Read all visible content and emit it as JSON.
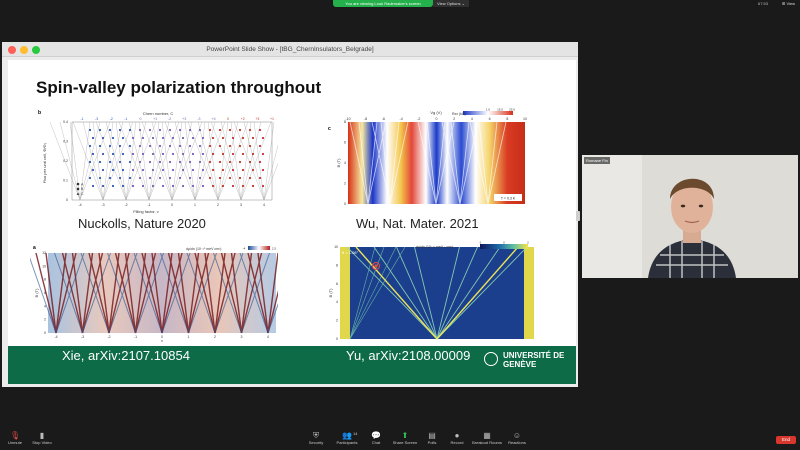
{
  "banner": {
    "share_text": "You are viewing Louk Rademaker's screen",
    "view_options": "View Options ⌄"
  },
  "top_right": {
    "status": "67:53",
    "view": "⊞ View"
  },
  "window": {
    "title": "PowerPoint Slide Show - [tBG_ChernInsulators_Belgrade]"
  },
  "slide": {
    "title": "Spin-valley polarization throughout",
    "captions": {
      "tl": "Nuckolls, Nature 2020",
      "tr": "Wu, Nat. Mater. 2021",
      "bl": "Xie, arXiv:2107.10854",
      "br": "Yu, arXiv:2108.00009"
    },
    "university": "UNIVERSITÉ DE GENÈVE"
  },
  "figures": {
    "tl": {
      "panel": "b",
      "top_label": "Chern number, C",
      "ylabel": "Flux per unit cell, Φ/Φ₀",
      "xlabel": "Filling factor, ν",
      "chern": [
        "-1",
        "-3",
        "-2",
        "-1",
        "0",
        "+1",
        "-2",
        "+3",
        "-3",
        "+4",
        "0",
        "+2",
        "+3",
        "+1"
      ],
      "xticks": [
        "-4",
        "-3",
        "-2",
        "-1",
        "0",
        "1",
        "2",
        "3",
        "4"
      ],
      "yticks": [
        "0",
        "0.1",
        "0.2",
        "0.3",
        "0.4"
      ],
      "legend": [
        "A",
        "B",
        "C"
      ]
    },
    "tr": {
      "panel": "c",
      "xlabel": "Vg (V)",
      "ylabel": "B (T)",
      "xticks": [
        "-10",
        "-8",
        "-6",
        "-4",
        "-2",
        "0",
        "2",
        "4",
        "6",
        "8",
        "10"
      ],
      "yticks": [
        "0",
        "2",
        "4",
        "6",
        "8"
      ],
      "cbar_label": "Rxx (kΩ)",
      "cbar_ticks": [
        "1.0",
        "15.0",
        "25.0"
      ],
      "temp": "T = 0.3 K"
    },
    "bl": {
      "panel": "a",
      "cbar_label": "dμ/dn (10⁻¹⁰ meV cm²)",
      "cbar_ticks": [
        "-4",
        "2.5"
      ],
      "ylabel": "B (T)",
      "yticks": [
        "0",
        "2",
        "4",
        "6",
        "8",
        "10",
        "12"
      ],
      "xticks": [
        "-4",
        "-3",
        "-2",
        "-1",
        "0",
        "1",
        "2",
        "3",
        "4"
      ],
      "xlabel": "ν"
    },
    "br": {
      "angle": "θ = 1.06°",
      "ylabel": "B (T)",
      "cbar_label": "dμ/dn (10⁻¹¹ meV · cm²)",
      "cbar_ticks": [
        "-1",
        "0",
        "2"
      ],
      "yticks": [
        "0",
        "2",
        "4",
        "6",
        "8",
        "10"
      ]
    }
  },
  "video": {
    "name": "Romane Fin"
  },
  "toolbar": {
    "items": [
      {
        "label": "Unmute",
        "icon": "microphone-muted-icon",
        "glyph": "🎙"
      },
      {
        "label": "Stop Video",
        "icon": "video-camera-icon",
        "glyph": "▮"
      },
      {
        "label": "Security",
        "icon": "shield-icon",
        "glyph": "⛨"
      },
      {
        "label": "Participants",
        "icon": "participants-icon",
        "glyph": "👥"
      },
      {
        "label": "Chat",
        "icon": "chat-icon",
        "glyph": "💬"
      },
      {
        "label": "Share Screen",
        "icon": "share-screen-icon",
        "glyph": "⬆"
      },
      {
        "label": "Polls",
        "icon": "polls-icon",
        "glyph": "▤"
      },
      {
        "label": "Record",
        "icon": "record-icon",
        "glyph": "●"
      },
      {
        "label": "Breakout Rooms",
        "icon": "breakout-rooms-icon",
        "glyph": "▦"
      },
      {
        "label": "Reactions",
        "icon": "reactions-icon",
        "glyph": "☺"
      }
    ],
    "participants_count": "14",
    "end": "End"
  },
  "colors": {
    "brand_green": "#0d6b47",
    "share_green": "#24b04b",
    "end_red": "#d7372c"
  }
}
